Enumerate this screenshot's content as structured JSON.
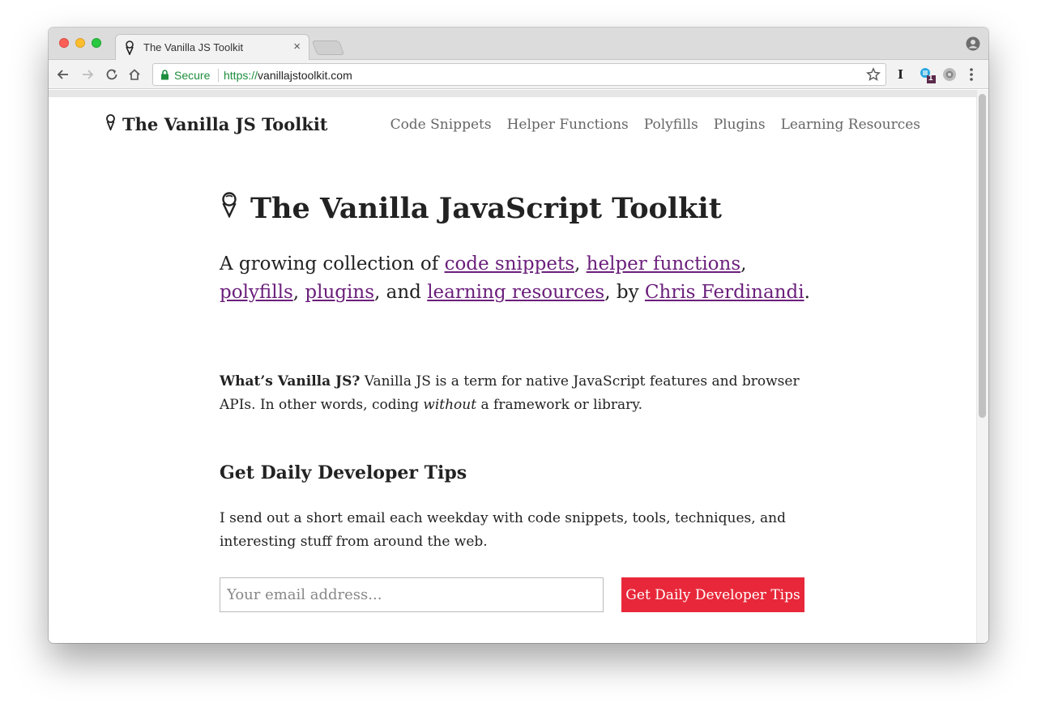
{
  "browser": {
    "tab_title": "The Vanilla JS Toolkit",
    "tab_close": "×",
    "secure_label": "Secure",
    "url_scheme": "https://",
    "url_host": "vanillajstoolkit.com",
    "extension_badge": "1",
    "extension_letter": "I"
  },
  "site": {
    "brand": "The Vanilla JS Toolkit",
    "nav": [
      "Code Snippets",
      "Helper Functions",
      "Polyfills",
      "Plugins",
      "Learning Resources"
    ]
  },
  "main": {
    "title": "The Vanilla JavaScript Toolkit",
    "lead": {
      "prefix": "A growing collection of ",
      "link1": "code snippets",
      "sep1": ", ",
      "link2": "helper functions",
      "sep2": ", ",
      "link3": "polyfills",
      "sep3": ", ",
      "link4": "plugins",
      "sep4": ", and ",
      "link5": "learning resources",
      "sep5": ", by ",
      "link6": "Chris Ferdinandi",
      "suffix": "."
    },
    "what": {
      "bold": "What’s Vanilla JS?",
      "text1": " Vanilla JS is a term for native JavaScript features and browser APIs. In other words, coding ",
      "italic": "without",
      "text2": " a framework or library."
    },
    "newsletter": {
      "heading": "Get Daily Developer Tips",
      "text": "I send out a short email each weekday with code snippets, tools, techniques, and interesting stuff from around the web.",
      "placeholder": "Your email address...",
      "button": "Get Daily Developer Tips"
    }
  },
  "colors": {
    "link": "#6b1f7b",
    "cta": "#e8283a",
    "secure": "#1e8e3e"
  }
}
